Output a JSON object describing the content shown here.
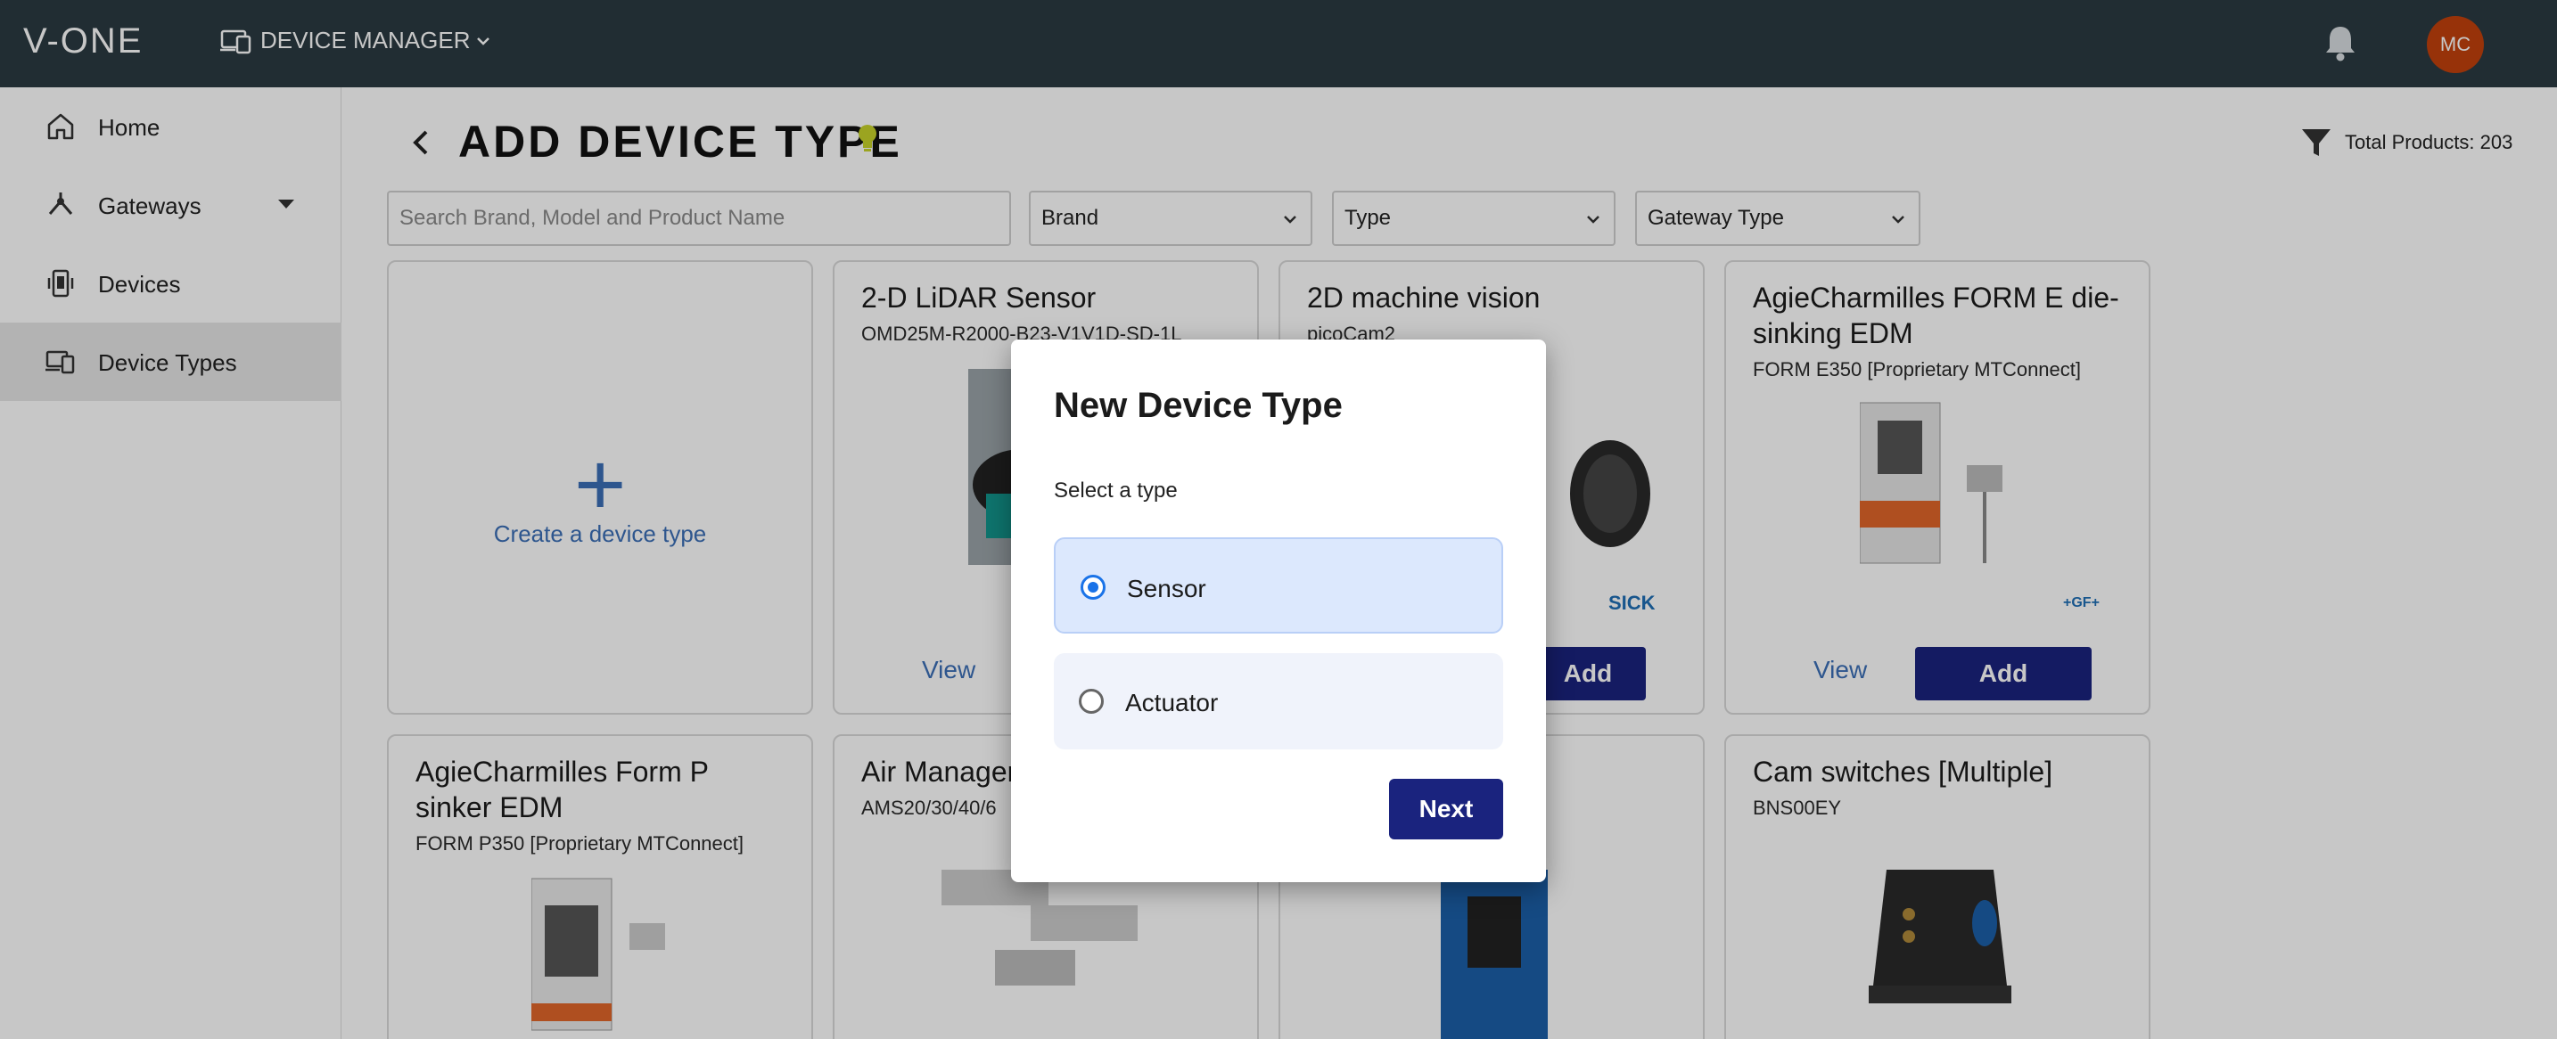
{
  "app": {
    "logo": "V-ONE",
    "section": "DEVICE MANAGER",
    "avatar_initials": "MC"
  },
  "sidebar": {
    "items": [
      {
        "label": "Home",
        "icon": "home-icon"
      },
      {
        "label": "Gateways",
        "icon": "gateway-icon"
      },
      {
        "label": "Devices",
        "icon": "device-icon"
      },
      {
        "label": "Device Types",
        "icon": "device-types-icon",
        "active": true
      }
    ]
  },
  "page": {
    "title": "ADD DEVICE TYPE",
    "total_products": "Total Products: 203"
  },
  "filters": {
    "search_placeholder": "Search Brand, Model and Product Name",
    "brand": "Brand",
    "type": "Type",
    "gateway_type": "Gateway Type"
  },
  "cards": {
    "create_label": "Create a device type",
    "items": [
      {
        "title": "2-D LiDAR Sensor",
        "subtitle": "OMD25M-R2000-B23-V1V1D-SD-1L",
        "view": "View"
      },
      {
        "title": "2D machine vision",
        "subtitle": "picoCam2",
        "brand": "SICK",
        "add": "Add"
      },
      {
        "title": "AgieCharmilles FORM E die-sinking EDM",
        "subtitle": "FORM E350 [Proprietary MTConnect]",
        "brand": "+GF+",
        "view": "View",
        "add": "Add"
      },
      {
        "title": "AgieCharmilles Form P sinker EDM",
        "subtitle": "FORM P350 [Proprietary MTConnect]"
      },
      {
        "title": "Air Manager",
        "subtitle": "AMS20/30/40/6"
      },
      {
        "title": "Cam switches [Multiple]",
        "subtitle": "BNS00EY"
      }
    ]
  },
  "dialog": {
    "title": "New Device Type",
    "subtitle": "Select a type",
    "options": [
      {
        "label": "Sensor",
        "selected": true
      },
      {
        "label": "Actuator",
        "selected": false
      }
    ],
    "next": "Next"
  }
}
